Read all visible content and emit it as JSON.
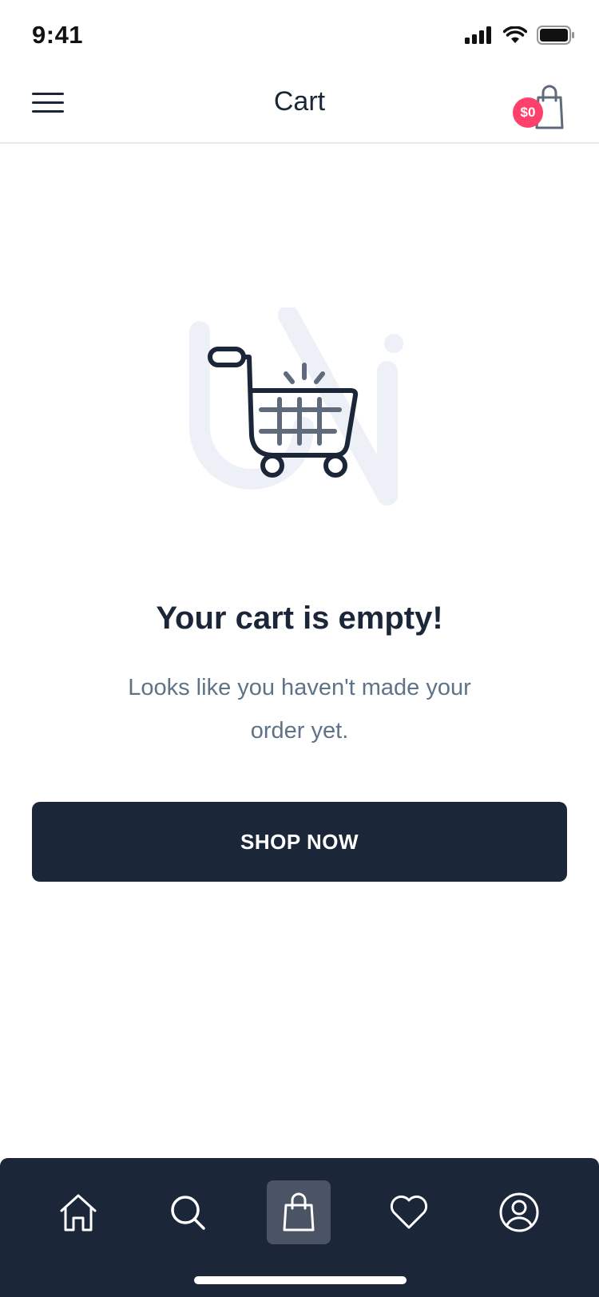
{
  "status_bar": {
    "time": "9:41",
    "icons": [
      "signal-icon",
      "wifi-icon",
      "battery-icon"
    ]
  },
  "header": {
    "title": "Cart",
    "menu_icon": "hamburger-menu-icon",
    "cart_icon": "shopping-bag-icon",
    "cart_badge": "$0"
  },
  "empty_state": {
    "illustration_icon": "shopping-cart-icon",
    "title": "Your cart is empty!",
    "subtitle": "Looks like you haven't made your order yet.",
    "button_label": "SHOP NOW"
  },
  "bottom_nav": {
    "items": [
      {
        "icon": "home-icon",
        "active": false
      },
      {
        "icon": "search-icon",
        "active": false
      },
      {
        "icon": "shopping-bag-icon",
        "active": true
      },
      {
        "icon": "heart-icon",
        "active": false
      },
      {
        "icon": "user-icon",
        "active": false
      }
    ]
  },
  "colors": {
    "primary": "#1b2639",
    "badge": "#ff3f6c",
    "subtitle": "#5f7388",
    "watermark": "#edf1f7",
    "active_nav": "#4a5465"
  }
}
